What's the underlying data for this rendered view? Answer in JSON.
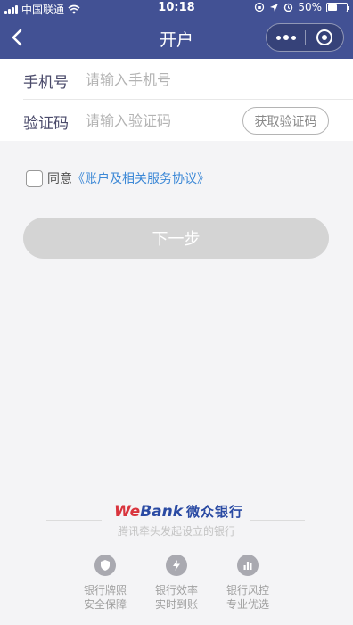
{
  "status_bar": {
    "carrier": "中国联通",
    "time": "10:18",
    "battery": "50%",
    "battery_level": 0.5
  },
  "nav": {
    "title": "开户"
  },
  "form": {
    "phone_label": "手机号",
    "phone_placeholder": "请输入手机号",
    "phone_value": "",
    "code_label": "验证码",
    "code_placeholder": "请输入验证码",
    "code_value": "",
    "get_code_label": "获取验证码"
  },
  "agreement": {
    "checked": false,
    "prefix": "同意",
    "link": "《账户及相关服务协议》"
  },
  "next_label": "下一步",
  "footer": {
    "logo_we": "We",
    "logo_bank": "Bank",
    "logo_cn": "微众银行",
    "slogan": "腾讯牵头发起设立的银行",
    "features": [
      {
        "icon": "shield-icon",
        "line1": "银行牌照",
        "line2": "安全保障"
      },
      {
        "icon": "lightning-icon",
        "line1": "银行效率",
        "line2": "实时到账"
      },
      {
        "icon": "bar-chart-icon",
        "line1": "银行风控",
        "line2": "专业优选"
      }
    ]
  },
  "colors": {
    "header_bg": "#425194",
    "link": "#3c88d6",
    "brand_blue": "#2a4aa3",
    "brand_red": "#d9343d",
    "button_disabled": "#d4d4d4"
  }
}
